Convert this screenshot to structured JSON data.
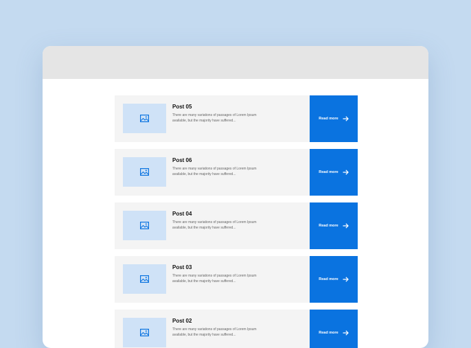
{
  "posts": [
    {
      "title": "Post 05",
      "desc": "There are many variations of passages of Lorem Ipsum available, but the majority have suffered...",
      "button": "Read more"
    },
    {
      "title": "Post 06",
      "desc": "There are many variations of passages of Lorem Ipsum available, but the majority have suffered...",
      "button": "Read more"
    },
    {
      "title": "Post 04",
      "desc": "There are many variations of passages of Lorem Ipsum available, but the majority have suffered...",
      "button": "Read more"
    },
    {
      "title": "Post 03",
      "desc": "There are many variations of passages of Lorem Ipsum available, but the majority have suffered...",
      "button": "Read more"
    },
    {
      "title": "Post 02",
      "desc": "There are many variations of passages of Lorem Ipsum available, but the majority have suffered...",
      "button": "Read more"
    }
  ],
  "icons": {
    "thumbnail": "image-icon",
    "button": "arrow-right-icon"
  },
  "colors": {
    "accent": "#0a73e0",
    "thumb": "#cfe2f7",
    "card": "#f4f4f4",
    "background": "#c4daf0"
  }
}
